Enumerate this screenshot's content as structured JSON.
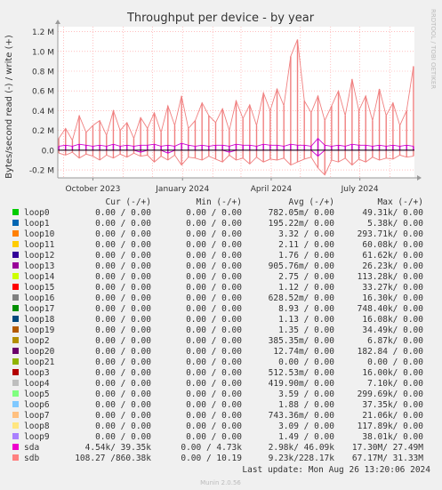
{
  "chart_data": {
    "type": "line",
    "title": "Throughput per device - by year",
    "ylabel": "Bytes/second read (-) / write (+)",
    "side_label": "RRDTOOL / TOBI OETIKER",
    "ylim": [
      -0.28,
      1.25
    ],
    "y_unit": "M",
    "y_ticks": [
      {
        "value": 1.2,
        "label": "1.2 M"
      },
      {
        "value": 1.0,
        "label": "1.0 M"
      },
      {
        "value": 0.8,
        "label": "0.8 M"
      },
      {
        "value": 0.6,
        "label": "0.6 M"
      },
      {
        "value": 0.4,
        "label": "0.4 M"
      },
      {
        "value": 0.2,
        "label": "0.2 M"
      },
      {
        "value": 0.0,
        "label": "0.0"
      },
      {
        "value": -0.2,
        "label": "-0.2 M"
      }
    ],
    "x_range": [
      "2023-08-26",
      "2024-08-26"
    ],
    "x_ticks": [
      {
        "date": "2023-10-01",
        "label": "October 2023"
      },
      {
        "date": "2024-01-01",
        "label": "January 2024"
      },
      {
        "date": "2024-04-01",
        "label": "April 2024"
      },
      {
        "date": "2024-07-01",
        "label": "July 2024"
      }
    ],
    "grid": true,
    "series_note": "Traffic envelope of device sdb (write +, read -) and sda (write), approximated in M bytes/second at roughly weekly samples",
    "series": [
      {
        "name": "sdb",
        "color": "#f08080",
        "dates": [
          "2023-08-27",
          "2023-09-03",
          "2023-09-10",
          "2023-09-17",
          "2023-09-24",
          "2023-10-01",
          "2023-10-08",
          "2023-10-15",
          "2023-10-22",
          "2023-10-29",
          "2023-11-05",
          "2023-11-12",
          "2023-11-19",
          "2023-11-26",
          "2023-12-03",
          "2023-12-10",
          "2023-12-17",
          "2023-12-24",
          "2023-12-31",
          "2024-01-07",
          "2024-01-14",
          "2024-01-21",
          "2024-01-28",
          "2024-02-04",
          "2024-02-11",
          "2024-02-18",
          "2024-02-25",
          "2024-03-03",
          "2024-03-10",
          "2024-03-17",
          "2024-03-24",
          "2024-03-31",
          "2024-04-07",
          "2024-04-14",
          "2024-04-21",
          "2024-04-28",
          "2024-05-05",
          "2024-05-12",
          "2024-05-19",
          "2024-05-26",
          "2024-06-02",
          "2024-06-09",
          "2024-06-16",
          "2024-06-23",
          "2024-06-30",
          "2024-07-07",
          "2024-07-14",
          "2024-07-21",
          "2024-07-28",
          "2024-08-04",
          "2024-08-11",
          "2024-08-18",
          "2024-08-25"
        ],
        "write": [
          0.12,
          0.22,
          0.1,
          0.35,
          0.18,
          0.25,
          0.3,
          0.15,
          0.4,
          0.2,
          0.28,
          0.12,
          0.33,
          0.22,
          0.38,
          0.18,
          0.45,
          0.25,
          0.55,
          0.22,
          0.3,
          0.48,
          0.35,
          0.28,
          0.42,
          0.2,
          0.5,
          0.32,
          0.46,
          0.25,
          0.58,
          0.4,
          0.62,
          0.45,
          0.95,
          1.12,
          0.5,
          0.38,
          0.55,
          0.3,
          0.45,
          0.6,
          0.35,
          0.72,
          0.4,
          0.55,
          0.3,
          0.62,
          0.35,
          0.48,
          0.25,
          0.4,
          0.85
        ],
        "read": [
          -0.03,
          -0.05,
          -0.02,
          -0.08,
          -0.04,
          -0.06,
          -0.1,
          -0.05,
          -0.08,
          -0.04,
          -0.07,
          -0.03,
          -0.06,
          -0.05,
          -0.12,
          -0.06,
          -0.1,
          -0.05,
          -0.15,
          -0.07,
          -0.08,
          -0.1,
          -0.06,
          -0.09,
          -0.12,
          -0.05,
          -0.1,
          -0.08,
          -0.14,
          -0.07,
          -0.12,
          -0.09,
          -0.1,
          -0.08,
          -0.15,
          -0.12,
          -0.09,
          -0.07,
          -0.18,
          -0.25,
          -0.1,
          -0.12,
          -0.08,
          -0.15,
          -0.09,
          -0.12,
          -0.07,
          -0.1,
          -0.08,
          -0.09,
          -0.05,
          -0.07,
          -0.06
        ]
      },
      {
        "name": "sda",
        "color": "#cc00cc",
        "write": [
          0.04,
          0.05,
          0.04,
          0.06,
          0.05,
          0.04,
          0.05,
          0.04,
          0.06,
          0.04,
          0.05,
          0.04,
          0.05,
          0.05,
          0.06,
          0.04,
          0.05,
          0.04,
          0.07,
          0.05,
          0.04,
          0.05,
          0.04,
          0.05,
          0.05,
          0.04,
          0.06,
          0.05,
          0.05,
          0.04,
          0.06,
          0.05,
          0.05,
          0.04,
          0.06,
          0.05,
          0.05,
          0.04,
          0.12,
          0.05,
          0.04,
          0.05,
          0.04,
          0.06,
          0.05,
          0.05,
          0.04,
          0.05,
          0.04,
          0.05,
          0.04,
          0.05,
          0.04
        ],
        "read": [
          0,
          0,
          0,
          0,
          0,
          0,
          0,
          0,
          0,
          0,
          0,
          0,
          -0.02,
          0,
          0,
          0,
          -0.03,
          0,
          0,
          0,
          0,
          0,
          0,
          0,
          0,
          -0.02,
          0,
          0,
          0,
          0,
          0,
          0,
          0,
          0,
          0,
          0,
          0,
          0,
          -0.06,
          0,
          0,
          0,
          0,
          0,
          0,
          0,
          0,
          0,
          0,
          0,
          0,
          0,
          0
        ]
      }
    ],
    "legend_header": {
      "cur": "Cur (-/+)",
      "min": "Min (-/+)",
      "avg": "Avg (-/+)",
      "max": "Max (-/+)"
    },
    "legend": [
      {
        "name": "loop0",
        "color": "#00cc00",
        "cur": "0.00 /  0.00",
        "min": "0.00 /  0.00",
        "avg": "782.05m/  0.00",
        "max": "49.31k/  0.00"
      },
      {
        "name": "loop1",
        "color": "#0066b3",
        "cur": "0.00 /  0.00",
        "min": "0.00 /  0.00",
        "avg": "195.22m/  0.00",
        "max": "5.38k/  0.00"
      },
      {
        "name": "loop10",
        "color": "#ff8000",
        "cur": "0.00 /  0.00",
        "min": "0.00 /  0.00",
        "avg": "3.32 /  0.00",
        "max": "293.71k/  0.00"
      },
      {
        "name": "loop11",
        "color": "#ffcc00",
        "cur": "0.00 /  0.00",
        "min": "0.00 /  0.00",
        "avg": "2.11 /  0.00",
        "max": "60.08k/  0.00"
      },
      {
        "name": "loop12",
        "color": "#330099",
        "cur": "0.00 /  0.00",
        "min": "0.00 /  0.00",
        "avg": "1.76 /  0.00",
        "max": "61.62k/  0.00"
      },
      {
        "name": "loop13",
        "color": "#990099",
        "cur": "0.00 /  0.00",
        "min": "0.00 /  0.00",
        "avg": "905.76m/  0.00",
        "max": "26.23k/  0.00"
      },
      {
        "name": "loop14",
        "color": "#ccff00",
        "cur": "0.00 /  0.00",
        "min": "0.00 /  0.00",
        "avg": "2.75 /  0.00",
        "max": "113.28k/  0.00"
      },
      {
        "name": "loop15",
        "color": "#ff0000",
        "cur": "0.00 /  0.00",
        "min": "0.00 /  0.00",
        "avg": "1.12 /  0.00",
        "max": "33.27k/  0.00"
      },
      {
        "name": "loop16",
        "color": "#808080",
        "cur": "0.00 /  0.00",
        "min": "0.00 /  0.00",
        "avg": "628.52m/  0.00",
        "max": "16.30k/  0.00"
      },
      {
        "name": "loop17",
        "color": "#008f00",
        "cur": "0.00 /  0.00",
        "min": "0.00 /  0.00",
        "avg": "8.93 /  0.00",
        "max": "748.40k/  0.00"
      },
      {
        "name": "loop18",
        "color": "#00487d",
        "cur": "0.00 /  0.00",
        "min": "0.00 /  0.00",
        "avg": "1.13 /  0.00",
        "max": "16.08k/  0.00"
      },
      {
        "name": "loop19",
        "color": "#b35a00",
        "cur": "0.00 /  0.00",
        "min": "0.00 /  0.00",
        "avg": "1.35 /  0.00",
        "max": "34.49k/  0.00"
      },
      {
        "name": "loop2",
        "color": "#b38f00",
        "cur": "0.00 /  0.00",
        "min": "0.00 /  0.00",
        "avg": "385.35m/  0.00",
        "max": "6.87k/  0.00"
      },
      {
        "name": "loop20",
        "color": "#6b006b",
        "cur": "0.00 /  0.00",
        "min": "0.00 /  0.00",
        "avg": "12.74m/  0.00",
        "max": "182.84 /  0.00"
      },
      {
        "name": "loop21",
        "color": "#8fb300",
        "cur": "0.00 /  0.00",
        "min": "0.00 /  0.00",
        "avg": "0.00 /  0.00",
        "max": "0.00 /  0.00"
      },
      {
        "name": "loop3",
        "color": "#b30000",
        "cur": "0.00 /  0.00",
        "min": "0.00 /  0.00",
        "avg": "512.53m/  0.00",
        "max": "16.00k/  0.00"
      },
      {
        "name": "loop4",
        "color": "#bebebe",
        "cur": "0.00 /  0.00",
        "min": "0.00 /  0.00",
        "avg": "419.90m/  0.00",
        "max": "7.10k/  0.00"
      },
      {
        "name": "loop5",
        "color": "#80ff80",
        "cur": "0.00 /  0.00",
        "min": "0.00 /  0.00",
        "avg": "3.59 /  0.00",
        "max": "299.69k/  0.00"
      },
      {
        "name": "loop6",
        "color": "#80c9ff",
        "cur": "0.00 /  0.00",
        "min": "0.00 /  0.00",
        "avg": "1.88 /  0.00",
        "max": "37.35k/  0.00"
      },
      {
        "name": "loop7",
        "color": "#ffc080",
        "cur": "0.00 /  0.00",
        "min": "0.00 /  0.00",
        "avg": "743.36m/  0.00",
        "max": "21.06k/  0.00"
      },
      {
        "name": "loop8",
        "color": "#ffe680",
        "cur": "0.00 /  0.00",
        "min": "0.00 /  0.00",
        "avg": "3.09 /  0.00",
        "max": "117.89k/  0.00"
      },
      {
        "name": "loop9",
        "color": "#aa80ff",
        "cur": "0.00 /  0.00",
        "min": "0.00 /  0.00",
        "avg": "1.49 /  0.00",
        "max": "38.01k/  0.00"
      },
      {
        "name": "sda",
        "color": "#ee00cc",
        "cur": "4.54k/ 39.35k",
        "min": "0.00 /  4.73k",
        "avg": "2.98k/ 46.09k",
        "max": "17.30M/ 27.49M"
      },
      {
        "name": "sdb",
        "color": "#ff8080",
        "cur": "108.27 /860.38k",
        "min": "0.00 / 10.19",
        "avg": "9.23k/228.17k",
        "max": "67.17M/ 31.33M"
      }
    ]
  },
  "footer": {
    "last_update": "Last update: Mon Aug 26 13:20:06 2024",
    "munin": "Munin 2.0.56"
  }
}
